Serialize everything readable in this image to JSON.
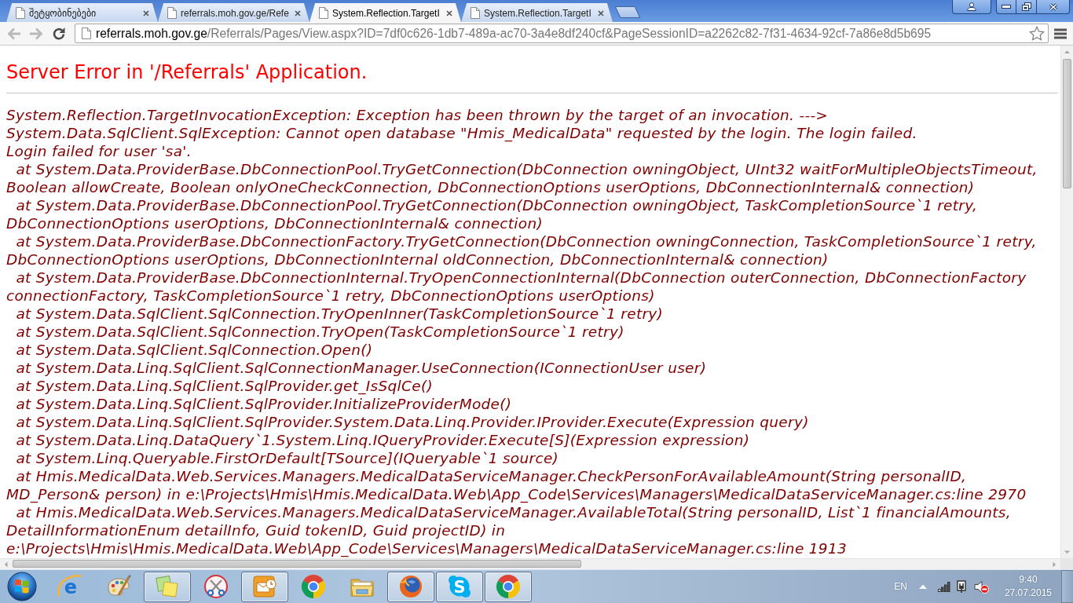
{
  "browser": {
    "tabs": [
      {
        "title": "შეტყობინებები",
        "selected": false
      },
      {
        "title": "referrals.moh.gov.ge/Refe",
        "selected": false
      },
      {
        "title": "System.Reflection.TargetI",
        "selected": true
      },
      {
        "title": "System.Reflection.TargetI",
        "selected": false
      }
    ],
    "toolbar": {
      "back": {
        "disabled": true
      },
      "forward": {
        "disabled": true
      },
      "url_host": "referrals.moh.gov.ge",
      "url_path": "/Referrals/Pages/View.aspx?ID=7df0c626-1db7-489a-ac70-3a4e8df240cf&PageSessionID=a2262c82-7f31-4634-92cf-7a86e8d5b695",
      "bookmarked": false
    }
  },
  "page": {
    "heading": "Server Error in '/Referrals' Application.",
    "message": [
      "System.Reflection.TargetInvocationException: Exception has been thrown by the target of an invocation. ---> System.Data.SqlClient.SqlException: Cannot open database \"Hmis_MedicalData\" requested by the login. The login failed.",
      "Login failed for user 'sa'."
    ],
    "stack_trace": [
      "  at System.Data.ProviderBase.DbConnectionPool.TryGetConnection(DbConnection owningObject, UInt32 waitForMultipleObjectsTimeout, Boolean allowCreate, Boolean onlyOneCheckConnection, DbConnectionOptions userOptions, DbConnectionInternal& connection)",
      "  at System.Data.ProviderBase.DbConnectionPool.TryGetConnection(DbConnection owningObject, TaskCompletionSource`1 retry, DbConnectionOptions userOptions, DbConnectionInternal& connection)",
      "  at System.Data.ProviderBase.DbConnectionFactory.TryGetConnection(DbConnection owningConnection, TaskCompletionSource`1 retry, DbConnectionOptions userOptions, DbConnectionInternal oldConnection, DbConnectionInternal& connection)",
      "  at System.Data.ProviderBase.DbConnectionInternal.TryOpenConnectionInternal(DbConnection outerConnection, DbConnectionFactory connectionFactory, TaskCompletionSource`1 retry, DbConnectionOptions userOptions)",
      "  at System.Data.SqlClient.SqlConnection.TryOpenInner(TaskCompletionSource`1 retry)",
      "  at System.Data.SqlClient.SqlConnection.TryOpen(TaskCompletionSource`1 retry)",
      "  at System.Data.SqlClient.SqlConnection.Open()",
      "  at System.Data.Linq.SqlClient.SqlConnectionManager.UseConnection(IConnectionUser user)",
      "  at System.Data.Linq.SqlClient.SqlProvider.get_IsSqlCe()",
      "  at System.Data.Linq.SqlClient.SqlProvider.InitializeProviderMode()",
      "  at System.Data.Linq.SqlClient.SqlProvider.System.Data.Linq.Provider.IProvider.Execute(Expression query)",
      "  at System.Data.Linq.DataQuery`1.System.Linq.IQueryProvider.Execute[S](Expression expression)",
      "  at System.Linq.Queryable.FirstOrDefault[TSource](IQueryable`1 source)",
      "  at Hmis.MedicalData.Web.Services.Managers.MedicalDataServiceManager.CheckPersonForAvailableAmount(String personalID, MD_Person& person) in e:\\Projects\\Hmis\\Hmis.MedicalData.Web\\App_Code\\Services\\Managers\\MedicalDataServiceManager.cs:line 2970",
      "  at Hmis.MedicalData.Web.Services.Managers.MedicalDataServiceManager.AvailableTotal(String personalID, List`1 financialAmounts, DetailInformationEnum detailInfo, Guid tokenID, Guid projectID) in e:\\Projects\\Hmis\\Hmis.MedicalData.Web\\App_Code\\Services\\Managers\\MedicalDataServiceManager.cs:line 1913"
    ]
  },
  "taskbar": {
    "apps": [
      {
        "kind": "ering",
        "glyph": "e",
        "running": false
      },
      {
        "kind": "palette",
        "running": false
      },
      {
        "kind": "notes",
        "running": true
      },
      {
        "kind": "scissors",
        "running": false
      },
      {
        "kind": "mail",
        "running": true
      },
      {
        "kind": "wheel",
        "running": false
      },
      {
        "kind": "folder",
        "running": false
      },
      {
        "kind": "fox",
        "running": true
      },
      {
        "kind": "cloud",
        "glyph": "S",
        "running": true
      },
      {
        "kind": "wheel",
        "running": true
      }
    ],
    "language": "EN",
    "sound_muted": true,
    "time": "9:40",
    "date": "27.07.2015"
  }
}
